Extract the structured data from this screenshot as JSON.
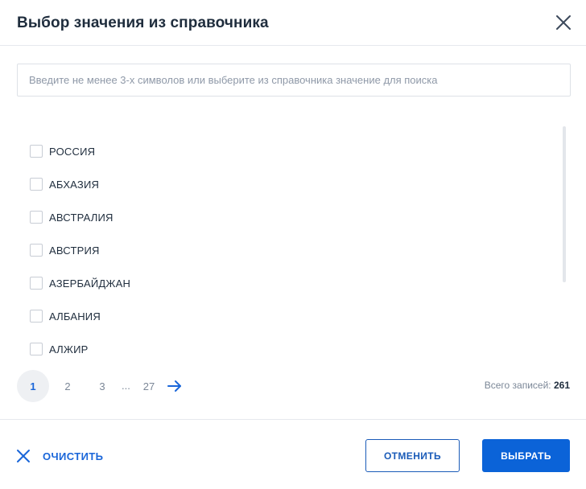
{
  "dialog": {
    "title": "Выбор значения из справочника"
  },
  "search": {
    "value": "",
    "placeholder": "Введите не менее 3-х символов или выберите из справочника значение для поиска"
  },
  "list": {
    "items": [
      {
        "label": "РОССИЯ",
        "checked": false
      },
      {
        "label": "АБХАЗИЯ",
        "checked": false
      },
      {
        "label": "АВСТРАЛИЯ",
        "checked": false
      },
      {
        "label": "АВСТРИЯ",
        "checked": false
      },
      {
        "label": "АЗЕРБАЙДЖАН",
        "checked": false
      },
      {
        "label": "АЛБАНИЯ",
        "checked": false
      },
      {
        "label": "АЛЖИР",
        "checked": false
      }
    ]
  },
  "pagination": {
    "pages": [
      "1",
      "2",
      "3"
    ],
    "ellipsis": "...",
    "last_page": "27",
    "current": "1",
    "total_label": "Всего записей:",
    "total_value": "261"
  },
  "footer": {
    "clear_label": "ОЧИСТИТЬ",
    "cancel_label": "ОТМЕНИТЬ",
    "select_label": "ВЫБРАТЬ"
  },
  "colors": {
    "accent": "#0b63d8",
    "text": "#1f2d3d",
    "muted": "#7b8797"
  },
  "icons": {
    "close": "close-icon",
    "next": "arrow-right-icon",
    "clear": "close-icon"
  }
}
